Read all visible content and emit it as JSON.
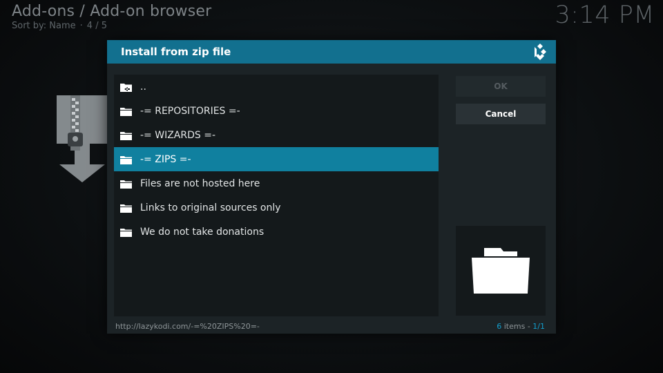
{
  "background": {
    "title": "Add-ons / Add-on browser",
    "sort_label": "Sort by: Name",
    "sort_separator": "·",
    "position": "4 / 5",
    "clock": "3:14 PM"
  },
  "dialog": {
    "title": "Install from zip file",
    "accent_color": "#12708f",
    "selected_color": "#10809f",
    "items": [
      {
        "label": "..",
        "icon": "back-folder-icon"
      },
      {
        "label": "-= REPOSITORIES  =-",
        "icon": "folder-icon"
      },
      {
        "label": "-= WIZARDS =-",
        "icon": "folder-icon"
      },
      {
        "label": "-= ZIPS =-",
        "icon": "folder-icon",
        "selected": true
      },
      {
        "label": "Files are not hosted here",
        "icon": "folder-icon"
      },
      {
        "label": "Links to original sources only",
        "icon": "folder-icon"
      },
      {
        "label": "We do not take donations",
        "icon": "folder-icon"
      }
    ],
    "buttons": {
      "ok_label": "OK",
      "cancel_label": "Cancel"
    },
    "footer": {
      "path": "http://lazykodi.com/-=%20ZIPS%20=-",
      "count": "6",
      "items_label": "items -",
      "page": "1/1"
    }
  }
}
